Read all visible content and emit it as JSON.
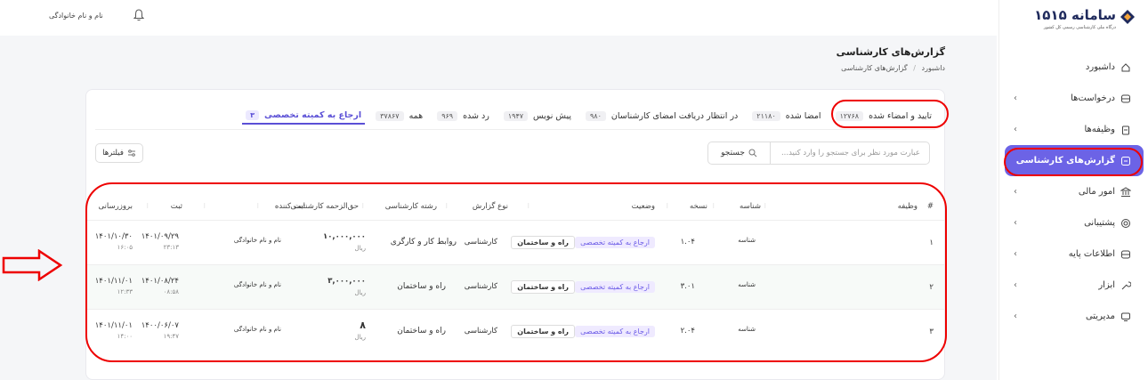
{
  "topbar": {
    "user_name": "نام و نام خانوادگی"
  },
  "sidebar": {
    "logo_text": "سامانه ۱۵۱۵",
    "logo_sub": "درگاه ملی کارشناسی رسمی کل کشور",
    "items": [
      {
        "label": "داشبورد",
        "icon": "home-icon",
        "chevron": false
      },
      {
        "label": "درخواست‌ها",
        "icon": "inbox-icon",
        "chevron": true
      },
      {
        "label": "وظیفه‌ها",
        "icon": "clipboard-icon",
        "chevron": true
      },
      {
        "label": "گزارش‌های کارشناسی",
        "icon": "report-icon",
        "chevron": false,
        "active": true
      },
      {
        "label": "امور مالی",
        "icon": "bank-icon",
        "chevron": true
      },
      {
        "label": "پشتیبانی",
        "icon": "support-icon",
        "chevron": true
      },
      {
        "label": "اطلاعات پایه",
        "icon": "database-icon",
        "chevron": true
      },
      {
        "label": "ابزار",
        "icon": "tool-icon",
        "chevron": true
      },
      {
        "label": "مدیریتی",
        "icon": "monitor-icon",
        "chevron": true
      }
    ]
  },
  "page": {
    "title": "گزارش‌های کارشناسی",
    "breadcrumb": [
      "داشبورد",
      "گزارش‌های کارشناسی"
    ]
  },
  "tabs": [
    {
      "label": "ارجاع به کمیته تخصصی",
      "count": "۳",
      "active": true
    },
    {
      "label": "همه",
      "count": "۳۷۸۶۷"
    },
    {
      "label": "رد شده",
      "count": "۹۶۹"
    },
    {
      "label": "پیش نویس",
      "count": "۱۹۴۷"
    },
    {
      "label": "در انتظار دریافت امضای کارشناسان",
      "count": "۹۸۰"
    },
    {
      "label": "امضا شده",
      "count": "۲۱۱۸۰"
    },
    {
      "label": "تایید و امضاء شده",
      "count": "۱۲۷۶۸"
    }
  ],
  "search": {
    "placeholder": "عبارت مورد نظر برای جستجو را وارد کنید...",
    "button": "جستجو"
  },
  "filter_button": "فیلترها",
  "table": {
    "columns": [
      "#",
      "وظیفه",
      "شناسه",
      "نسخه",
      "وضعیت",
      "نوع گزارش",
      "رشته کارشناسی",
      "حق‌الزحمه کارشناسی",
      "ثبت کننده",
      "ثبت",
      "بروزرسانی"
    ],
    "rows": [
      {
        "num": "۱",
        "id": "شناسه",
        "version": "۱.۰۴",
        "status": "ارجاع به کمیته تخصصی",
        "field_tag": "راه و ساختمان",
        "type": "کارشناسی",
        "field": "روابط کار و کارگری",
        "fee": "۱۰,۰۰۰,۰۰۰",
        "currency": "ریال",
        "registrar": "نام و نام خانوادگی",
        "reg_date": "۱۴۰۱/۰۹/۲۹",
        "reg_time": "۲۳:۱۳",
        "upd_date": "۱۴۰۱/۱۰/۳۰",
        "upd_time": "۱۶:۰۵"
      },
      {
        "num": "۲",
        "id": "شناسه",
        "version": "۳.۰۱",
        "status": "ارجاع به کمیته تخصصی",
        "field_tag": "راه و ساختمان",
        "type": "کارشناسی",
        "field": "راه و ساختمان",
        "fee": "۳,۰۰۰,۰۰۰",
        "currency": "ریال",
        "registrar": "نام و نام خانوادگی",
        "reg_date": "۱۴۰۱/۰۸/۲۴",
        "reg_time": "۰۸:۵۸",
        "upd_date": "۱۴۰۱/۱۱/۰۱",
        "upd_time": "۱۲:۳۳"
      },
      {
        "num": "۳",
        "id": "شناسه",
        "version": "۲.۰۴",
        "status": "ارجاع به کمیته تخصصی",
        "field_tag": "راه و ساختمان",
        "type": "کارشناسی",
        "field": "راه و ساختمان",
        "fee": "۸",
        "currency": "ریال",
        "registrar": "نام و نام خانوادگی",
        "reg_date": "۱۴۰۰/۰۶/۰۷",
        "reg_time": "۱۹:۴۷",
        "upd_date": "۱۴۰۱/۱۱/۰۱",
        "upd_time": "۱۴:۰۰"
      }
    ]
  },
  "colors": {
    "accent": "#6c63e6",
    "annotation": "#e00000"
  }
}
